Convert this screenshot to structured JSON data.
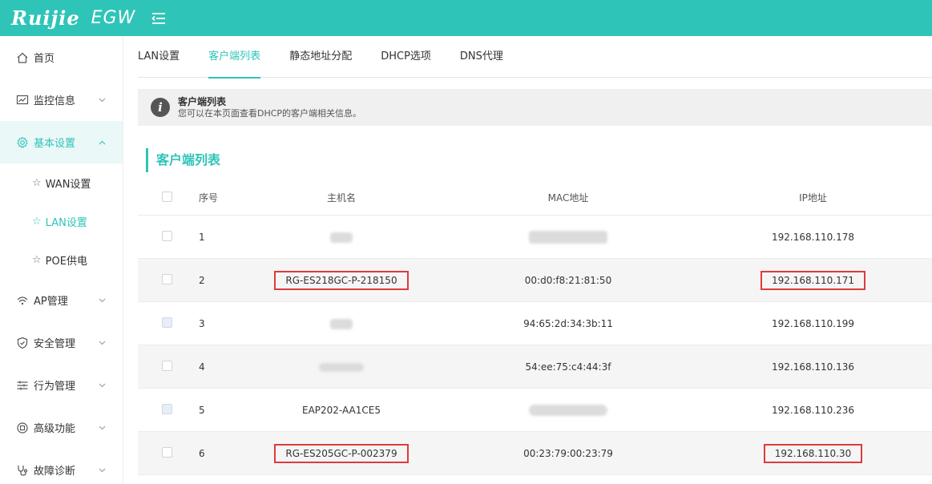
{
  "header": {
    "brand": "Ruijie",
    "product": "EGW"
  },
  "sidebar": {
    "items": [
      {
        "label": "首页"
      },
      {
        "label": "监控信息"
      },
      {
        "label": "基本设置"
      },
      {
        "label": "AP管理"
      },
      {
        "label": "安全管理"
      },
      {
        "label": "行为管理"
      },
      {
        "label": "高级功能"
      },
      {
        "label": "故障诊断"
      }
    ],
    "sub_items": [
      {
        "label": "WAN设置"
      },
      {
        "label": "LAN设置"
      },
      {
        "label": "POE供电"
      }
    ]
  },
  "tabs": [
    {
      "label": "LAN设置"
    },
    {
      "label": "客户端列表"
    },
    {
      "label": "静态地址分配"
    },
    {
      "label": "DHCP选项"
    },
    {
      "label": "DNS代理"
    }
  ],
  "info": {
    "title": "客户端列表",
    "desc": "您可以在本页面查看DHCP的客户端相关信息。"
  },
  "section_title": "客户端列表",
  "table": {
    "columns": {
      "idx": "序号",
      "host": "主机名",
      "mac": "MAC地址",
      "ip": "IP地址"
    },
    "rows": [
      {
        "idx": "1",
        "host": "",
        "mac": "",
        "ip": "192.168.110.178"
      },
      {
        "idx": "2",
        "host": "RG-ES218GC-P-218150",
        "mac": "00:d0:f8:21:81:50",
        "ip": "192.168.110.171"
      },
      {
        "idx": "3",
        "host": "",
        "mac": "94:65:2d:34:3b:11",
        "ip": "192.168.110.199"
      },
      {
        "idx": "4",
        "host": "",
        "mac": "54:ee:75:c4:44:3f",
        "ip": "192.168.110.136"
      },
      {
        "idx": "5",
        "host": "EAP202-AA1CE5",
        "mac": "",
        "ip": "192.168.110.236"
      },
      {
        "idx": "6",
        "host": "RG-ES205GC-P-002379",
        "mac": "00:23:79:00:23:79",
        "ip": "192.168.110.30"
      }
    ]
  },
  "colors": {
    "accent": "#2fc4b8",
    "highlight": "#e03a3a"
  }
}
